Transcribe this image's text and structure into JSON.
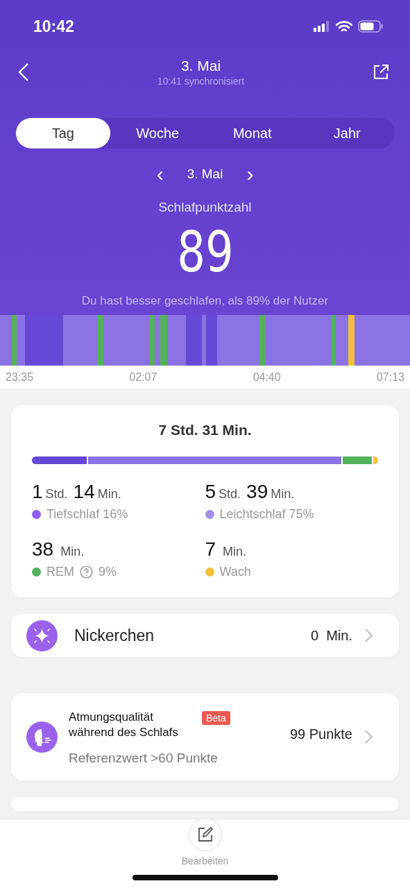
{
  "status_bar": {
    "time": "10:42"
  },
  "header": {
    "title": "3. Mai",
    "subtitle": "10:41 synchronisiert"
  },
  "tabs": [
    {
      "label": "Tag",
      "selected": true
    },
    {
      "label": "Woche",
      "selected": false
    },
    {
      "label": "Monat",
      "selected": false
    },
    {
      "label": "Jahr",
      "selected": false
    }
  ],
  "date_nav": {
    "prev": "‹",
    "date": "3. Mai",
    "next": "›"
  },
  "score": {
    "label": "Schlafpunktzahl",
    "value": "89",
    "comparison": "Du hast besser geschlafen, als 89% der Nutzer"
  },
  "timeline": {
    "times": [
      "23:35",
      "02:07",
      "04:40",
      "07:13"
    ]
  },
  "summary": {
    "total": "7 Std. 31 Min.",
    "bar": [
      {
        "color": "#6549d6"
      },
      {
        "color": "#8b73e3"
      },
      {
        "color": "#52b35a"
      },
      {
        "color": "#f5bf3c"
      }
    ],
    "stages": [
      {
        "hours": "1",
        "hours_unit": "Std.",
        "minutes": "14",
        "minutes_unit": "Min.",
        "label": "Tiefschlaf 16%",
        "color": "#8e5ef0",
        "info": false
      },
      {
        "hours": "5",
        "hours_unit": "Std.",
        "minutes": "39",
        "minutes_unit": "Min.",
        "label": "Leichtschlaf 75%",
        "color": "#a38fe8",
        "info": false
      },
      {
        "minutes": "38",
        "minutes_unit": "Min.",
        "label": "REM",
        "percent": "9%",
        "color": "#52b35a",
        "info": true
      },
      {
        "minutes": "7",
        "minutes_unit": "Min.",
        "label": "Wach",
        "color": "#f5bf3c",
        "info": false
      }
    ]
  },
  "cards": [
    {
      "kind": "nap",
      "title": "Nickerchen",
      "value": "0",
      "unit": "Min."
    },
    {
      "kind": "breathing",
      "title": "Atmungsqualität während des Schlafs",
      "badge": "Beta",
      "value": "99 Punkte",
      "note": "Referenzwert >60 Punkte"
    }
  ],
  "bottom_bar": {
    "label": "Bearbeiten"
  }
}
